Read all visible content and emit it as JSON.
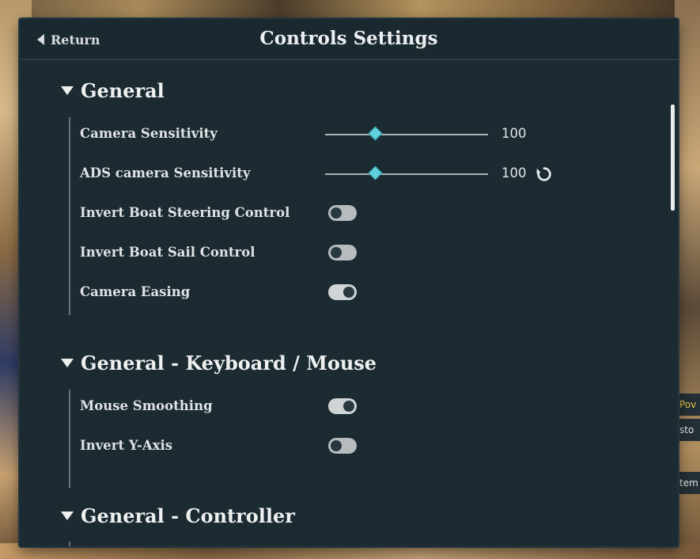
{
  "header": {
    "return_label": "Return",
    "title": "Controls Settings"
  },
  "side_chips": [
    "Pov",
    "sto",
    "tem"
  ],
  "sections": [
    {
      "title": "General",
      "settings": [
        {
          "label": "Camera Sensitivity",
          "type": "slider",
          "value": "100",
          "fill": 0.31
        },
        {
          "label": "ADS camera Sensitivity",
          "type": "slider",
          "value": "100",
          "fill": 0.31,
          "reset_icon": "reset-icon"
        },
        {
          "label": "Invert Boat Steering Control",
          "type": "toggle",
          "state": "off"
        },
        {
          "label": "Invert Boat Sail Control",
          "type": "toggle",
          "state": "off"
        },
        {
          "label": "Camera Easing",
          "type": "toggle",
          "state": "on"
        }
      ]
    },
    {
      "title": "General - Keyboard / Mouse",
      "settings": [
        {
          "label": "Mouse Smoothing",
          "type": "toggle",
          "state": "on"
        },
        {
          "label": "Invert Y-Axis",
          "type": "toggle",
          "state": "off"
        }
      ]
    },
    {
      "title": "General - Controller",
      "settings": []
    }
  ],
  "colors": {
    "panel": "#1c2a32",
    "accent": "#5fd0dc",
    "text": "#dfe3e4"
  }
}
